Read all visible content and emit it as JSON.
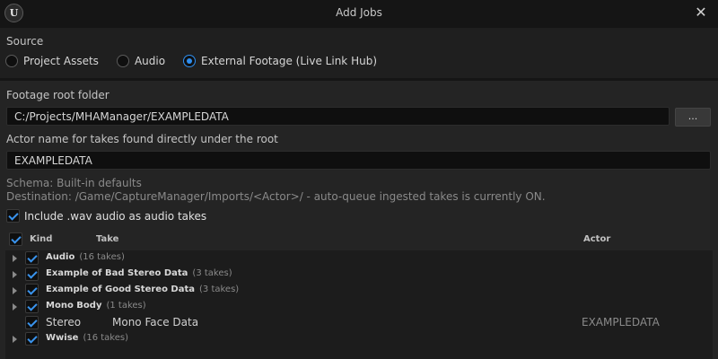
{
  "window": {
    "title": "Add Jobs",
    "logo_glyph": "U",
    "close_glyph": "✕"
  },
  "source": {
    "label": "Source",
    "options": [
      {
        "label": "Project Assets",
        "selected": false
      },
      {
        "label": "Audio",
        "selected": false
      },
      {
        "label": "External Footage (Live Link Hub)",
        "selected": true
      }
    ]
  },
  "footage": {
    "label": "Footage root folder",
    "value": "C:/Projects/MHAManager/EXAMPLEDATA",
    "browse_label": "..."
  },
  "actor": {
    "label": "Actor name for takes found directly under the root",
    "value": "EXAMPLEDATA"
  },
  "info": {
    "schema": "Schema: Built-in defaults",
    "destination": "Destination: /Game/CaptureManager/Imports/<Actor>/ - auto-queue ingested takes is currently ON."
  },
  "include_wav": {
    "label": "Include .wav audio as audio takes",
    "checked": true
  },
  "table": {
    "columns": {
      "kind": "Kind",
      "take": "Take",
      "actor": "Actor"
    },
    "select_all_checked": true,
    "rows": [
      {
        "type": "group",
        "name": "Audio",
        "count": "(16 takes)",
        "checked": true
      },
      {
        "type": "group",
        "name": "Example of Bad Stereo Data",
        "count": "(3 takes)",
        "checked": true
      },
      {
        "type": "group",
        "name": "Example of Good Stereo Data",
        "count": "(3 takes)",
        "checked": true
      },
      {
        "type": "group",
        "name": "Mono Body",
        "count": "(1 takes)",
        "checked": true
      },
      {
        "type": "item",
        "kind": "Stereo",
        "take": "Mono Face Data",
        "actor": "EXAMPLEDATA",
        "checked": true
      },
      {
        "type": "group",
        "name": "Wwise",
        "count": "(16 takes)",
        "checked": true
      }
    ]
  },
  "icons": {
    "close": "close-icon",
    "logo": "unreal-logo-icon",
    "expander": "chevron-right-icon",
    "check": "checkmark-icon"
  },
  "colors": {
    "accent": "#2f8ff0",
    "window_bg": "#151515",
    "panel_bg": "#242424",
    "input_bg": "#0f0f0f"
  }
}
